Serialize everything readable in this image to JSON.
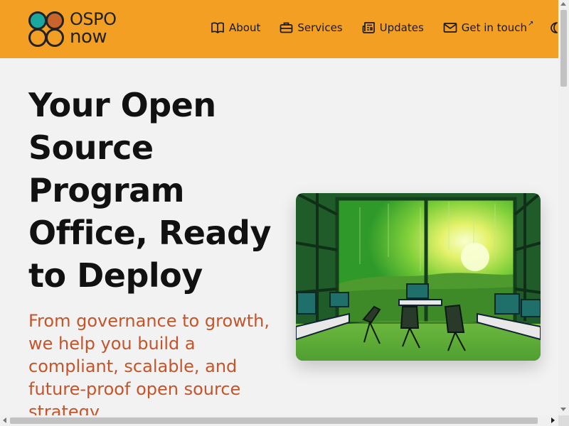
{
  "brand": {
    "line1": "OSPO",
    "line2": "now",
    "colors": {
      "teal": "#1aa7a0",
      "orange": "#c9642c",
      "header_bg": "#f29f24"
    }
  },
  "nav": {
    "items": [
      {
        "label": "About",
        "icon": "book-open-icon"
      },
      {
        "label": "Services",
        "icon": "briefcase-icon"
      },
      {
        "label": "Updates",
        "icon": "newspaper-icon"
      },
      {
        "label": "Get in touch",
        "icon": "mail-icon",
        "external": true,
        "external_glyph": "↗"
      }
    ],
    "theme_toggle_icon": "moon-icon"
  },
  "hero": {
    "title": "Your Open Source Program Office, Ready to Deploy",
    "subtitle": "From governance to growth, we help you build a compliant, scalable, and future-proof open source strategy",
    "subtitle_color": "#c4552b"
  }
}
